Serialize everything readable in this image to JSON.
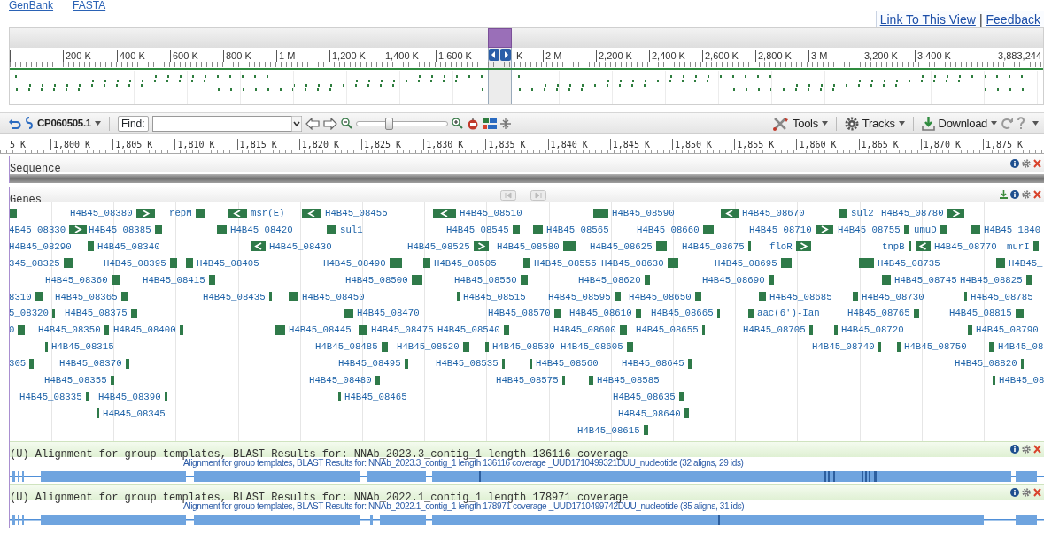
{
  "top_links": [
    {
      "label": "GenBank"
    },
    {
      "label": "FASTA"
    }
  ],
  "view_links": [
    {
      "label": "Link To This View"
    },
    {
      "label": "Feedback"
    }
  ],
  "view_link_separator": "|",
  "overview": {
    "ruler": [
      "200 K",
      "400 K",
      "600 K",
      "800 K",
      "1 M",
      "1,200 K",
      "1,400 K",
      "1,600 K",
      "K",
      "2 M",
      "2,200 K",
      "2,400 K",
      "2,600 K",
      "2,800 K",
      "3 M",
      "3,200 K",
      "3,400 K"
    ],
    "end_label": "3,883,244"
  },
  "toolbar": {
    "sequence_id": "CP060505.1",
    "find_label": "Find:",
    "zoom": {
      "level": 0.36
    },
    "menus": [
      {
        "label": "Tools",
        "kind": "tools"
      },
      {
        "label": "Tracks",
        "kind": "tracks"
      },
      {
        "label": "Download",
        "kind": "download"
      }
    ]
  },
  "ruler": [
    "5 K",
    "1,800 K",
    "1,805 K",
    "1,810 K",
    "1,815 K",
    "1,820 K",
    "1,825 K",
    "1,830 K",
    "1,835 K",
    "1,840 K",
    "1,845 K",
    "1,850 K",
    "1,855 K",
    "1,860 K",
    "1,865 K",
    "1,870 K",
    "1,875 K"
  ],
  "tracks": [
    {
      "kind": "sequence",
      "title": "Sequence"
    },
    {
      "kind": "genes",
      "title": "Genes",
      "lanes": [
        [
          {
            "kind": "block"
          },
          {
            "label": "H4B45_08380",
            "kind": "right",
            "marker_first": false
          },
          {
            "label": "repM",
            "kind": "block",
            "marker_first": false
          },
          {
            "label": "msr(E)",
            "kind": "left",
            "marker_first": true
          },
          {
            "label": "H4B45_08455",
            "kind": "left",
            "marker_first": true
          },
          {
            "label": "H4B45_08510",
            "kind": "left",
            "marker_first": true
          },
          {
            "label": "H4B45_08590",
            "kind": "block",
            "marker_first": true
          },
          {
            "label": "H4B45_08670",
            "kind": "left",
            "marker_first": true
          },
          {
            "label": "sul2",
            "kind": "block",
            "marker_first": true
          },
          {
            "label": "H4B45_08780",
            "kind": "right",
            "marker_first": false
          }
        ],
        [
          {
            "label": "4B45_08330",
            "kind": "right",
            "marker_first": false
          },
          {
            "label": "H4B45_08385",
            "kind": "block",
            "marker_first": false
          },
          {
            "label": "H4B45_08420",
            "kind": "block",
            "marker_first": true
          },
          {
            "label": "sul1",
            "kind": "block",
            "marker_first": true
          },
          {
            "label": "H4B45_08545",
            "kind": "block",
            "marker_first": false
          },
          {
            "label": "H4B45_08565",
            "kind": "block",
            "marker_first": true
          },
          {
            "label": "H4B45_08660",
            "kind": "block",
            "marker_first": false
          },
          {
            "label": "H4B45_08710",
            "kind": "right",
            "marker_first": false
          },
          {
            "label": "H4B45_08755",
            "kind": "block",
            "marker_first": false
          },
          {
            "label": "umuD",
            "kind": "block",
            "marker_first": false
          },
          {
            "label": "H4B45_1840",
            "kind": "block",
            "marker_first": true
          }
        ],
        [
          {
            "label": "H4B45_08290"
          },
          {
            "label": "H4B45_08340",
            "kind": "block",
            "marker_first": true
          },
          {
            "label": "H4B45_08430",
            "kind": "left",
            "marker_first": true
          },
          {
            "label": "H4B45_08525",
            "kind": "right",
            "marker_first": false
          },
          {
            "label": "H4B45_08580",
            "kind": "block",
            "marker_first": false
          },
          {
            "label": "H4B45_08625",
            "kind": "block",
            "marker_first": false
          },
          {
            "label": "H4B45_08675",
            "kind": "bar",
            "marker_first": false
          },
          {
            "label": "floR",
            "kind": "right",
            "marker_first": false
          },
          {
            "label": "tnpB",
            "kind": "bar",
            "marker_first": false
          },
          {
            "label": "H4B45_08770",
            "kind": "left",
            "marker_first": true
          },
          {
            "label": "murI",
            "kind": "block",
            "marker_first": false
          }
        ],
        [
          {
            "label": "345_08325",
            "kind": "block",
            "marker_first": false
          },
          {
            "label": "H4B45_08395",
            "kind": "block",
            "marker_first": false
          },
          {
            "label": "H4B45_08405",
            "kind": "block",
            "marker_first": true
          },
          {
            "label": "H4B45_08490",
            "kind": "block",
            "marker_first": false
          },
          {
            "label": "H4B45_08505",
            "kind": "block",
            "marker_first": true
          },
          {
            "label": "H4B45_08555",
            "kind": "block",
            "marker_first": true
          },
          {
            "label": "H4B45_08630",
            "kind": "block",
            "marker_first": false
          },
          {
            "label": "H4B45_08695",
            "kind": "block",
            "marker_first": false
          },
          {
            "label": "H4B45_08735",
            "kind": "block",
            "marker_first": true
          },
          {
            "label": "H4B45_",
            "kind": "block",
            "marker_first": true
          }
        ],
        [
          {
            "label": "H4B45_08360",
            "kind": "block",
            "marker_first": false
          },
          {
            "label": "H4B45_08415",
            "kind": "block",
            "marker_first": false
          },
          {
            "label": "H4B45_08500",
            "kind": "block",
            "marker_first": false
          },
          {
            "label": "H4B45_08550",
            "kind": "block",
            "marker_first": false
          },
          {
            "label": "H4B45_08620",
            "kind": "block",
            "marker_first": false
          },
          {
            "label": "H4B45_08690",
            "kind": "block",
            "marker_first": false
          },
          {
            "label": "H4B45_08745",
            "kind": "block",
            "marker_first": true
          },
          {
            "label": "H4B45_08825",
            "kind": "block",
            "marker_first": false
          }
        ],
        [
          {
            "label": "8310",
            "kind": "block",
            "marker_first": false
          },
          {
            "label": "H4B45_08365",
            "kind": "block",
            "marker_first": false
          },
          {
            "label": "H4B45_08435",
            "kind": "bar",
            "marker_first": false
          },
          {
            "label": "H4B45_08450",
            "kind": "block",
            "marker_first": true
          },
          {
            "label": "H4B45_08515",
            "kind": "bar",
            "marker_first": true
          },
          {
            "label": "H4B45_08595",
            "kind": "block",
            "marker_first": false
          },
          {
            "label": "H4B45_08650",
            "kind": "block",
            "marker_first": false
          },
          {
            "label": "H4B45_08685",
            "kind": "block",
            "marker_first": true
          },
          {
            "label": "H4B45_08730",
            "kind": "block",
            "marker_first": true
          },
          {
            "label": "H4B45_08785",
            "kind": "bar",
            "marker_first": true
          }
        ],
        [
          {
            "label": "5_08320",
            "kind": "bar",
            "marker_first": false
          },
          {
            "label": "H4B45_08375",
            "kind": "block",
            "marker_first": false
          },
          {
            "label": "H4B45_08470",
            "kind": "block",
            "marker_first": true
          },
          {
            "label": "H4B45_08570",
            "kind": "block",
            "marker_first": false
          },
          {
            "label": "H4B45_08610",
            "kind": "block",
            "marker_first": false
          },
          {
            "label": "H4B45_08665",
            "kind": "bar",
            "marker_first": false
          },
          {
            "label": "aac(6')-Ian",
            "kind": "block",
            "marker_first": true
          },
          {
            "label": "H4B45_08765",
            "kind": "block",
            "marker_first": false
          },
          {
            "label": "H4B45_08815",
            "kind": "block",
            "marker_first": false
          }
        ],
        [
          {
            "label": "0",
            "kind": "block",
            "marker_first": false
          },
          {
            "label": "H4B45_08350",
            "kind": "block",
            "marker_first": false
          },
          {
            "label": "H4B45_08400",
            "kind": "block",
            "marker_first": false
          },
          {
            "label": "H4B45_08445",
            "kind": "block",
            "marker_first": true
          },
          {
            "label": "H4B45_08475",
            "kind": "block",
            "marker_first": true
          },
          {
            "label": "H4B45_08540",
            "kind": "block",
            "marker_first": false
          },
          {
            "label": "H4B45_08600",
            "kind": "block",
            "marker_first": false
          },
          {
            "label": "H4B45_08655",
            "kind": "bar",
            "marker_first": false
          },
          {
            "label": "H4B45_08705",
            "kind": "block",
            "marker_first": false
          },
          {
            "label": "H4B45_08720",
            "kind": "block",
            "marker_first": true
          },
          {
            "label": "H4B45_08790",
            "kind": "block",
            "marker_first": true
          }
        ],
        [
          {
            "label": "H4B45_08315",
            "kind": "bar",
            "marker_first": true
          },
          {
            "label": "H4B45_08485",
            "kind": "block",
            "marker_first": false
          },
          {
            "label": "H4B45_08520",
            "kind": "block",
            "marker_first": false
          },
          {
            "label": "H4B45_08530",
            "kind": "block",
            "marker_first": true
          },
          {
            "label": "H4B45_08605",
            "kind": "block",
            "marker_first": false
          },
          {
            "label": "H4B45_08740",
            "kind": "bar",
            "marker_first": false
          },
          {
            "label": "H4B45_08750",
            "kind": "block",
            "marker_first": true
          },
          {
            "label": "H4B45_08",
            "kind": "block",
            "marker_first": true
          }
        ],
        [
          {
            "label": "305",
            "kind": "block",
            "marker_first": false
          },
          {
            "label": "H4B45_08370",
            "kind": "block",
            "marker_first": false
          },
          {
            "label": "H4B45_08495",
            "kind": "block",
            "marker_first": false
          },
          {
            "label": "H4B45_08535",
            "kind": "bar",
            "marker_first": false
          },
          {
            "label": "H4B45_08560",
            "kind": "bar",
            "marker_first": true
          },
          {
            "label": "H4B45_08645",
            "kind": "block",
            "marker_first": false
          },
          {
            "label": "H4B45_08820",
            "kind": "bar",
            "marker_first": false
          }
        ],
        [
          {
            "label": "H4B45_08355",
            "kind": "block",
            "marker_first": false
          },
          {
            "label": "H4B45_08480",
            "kind": "block",
            "marker_first": false
          },
          {
            "label": "H4B45_08575",
            "kind": "bar",
            "marker_first": false
          },
          {
            "label": "H4B45_08585",
            "kind": "block",
            "marker_first": true
          },
          {
            "label": "H4B45_08",
            "kind": "bar",
            "marker_first": true
          }
        ],
        [
          {
            "label": "H4B45_08335",
            "kind": "bar",
            "marker_first": false
          },
          {
            "label": "H4B45_08390",
            "kind": "bar",
            "marker_first": false
          },
          {
            "label": "H4B45_08465",
            "kind": "bar",
            "marker_first": true
          },
          {
            "label": "H4B45_08635",
            "kind": "block",
            "marker_first": false
          }
        ],
        [
          {
            "label": "H4B45_08345",
            "kind": "bar",
            "marker_first": true
          },
          {
            "label": "H4B45_08640",
            "kind": "block",
            "marker_first": false
          }
        ],
        [
          {
            "label": "H4B45_08615",
            "kind": "block",
            "marker_first": false
          }
        ]
      ]
    },
    {
      "kind": "alignment",
      "title": "(U) Alignment for group templates, BLAST Results for: NNAb_2023.3_contig_1 length 136116 coverage",
      "subtitle": "Alignment for group templates, BLAST Results for:  NNAb_2023.3_contig_1 length 136116 coverage _UUD1710499321DUU_nucleotide (32 aligns, 29 ids)"
    },
    {
      "kind": "alignment",
      "title": "(U) Alignment for group templates, BLAST Results for: NNAb_2022.1_contig_1 length 178971 coverage",
      "subtitle": "Alignment for group templates, BLAST Results for:  NNAb_2022.1_contig_1 length 178971 coverage _UUD1710499742DUU_nucleotide (35 aligns, 31 ids)"
    }
  ]
}
